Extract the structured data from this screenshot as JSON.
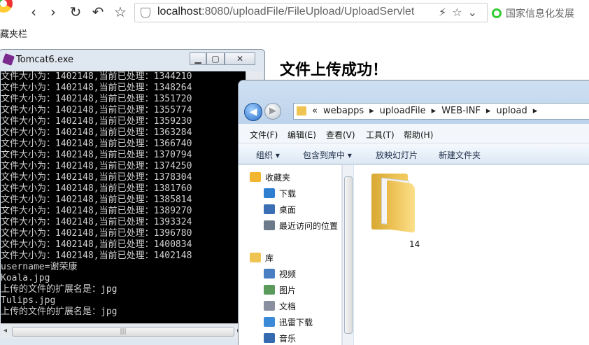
{
  "browser": {
    "address_host": "localhost",
    "address_path": ":8080/uploadFile/FileUpload/UploadServlet",
    "search_text": "国家信息化发展",
    "bookmarks_label": "藏夹栏"
  },
  "page": {
    "heading": "文件上传成功！"
  },
  "console": {
    "title": "Tomcat6.exe",
    "lines": [
      "文件大小为：1402148,当前已处理：1344210",
      "文件大小为：1402148,当前已处理：1348264",
      "文件大小为：1402148,当前已处理：1351720",
      "文件大小为：1402148,当前已处理：1355774",
      "文件大小为：1402148,当前已处理：1359230",
      "文件大小为：1402148,当前已处理：1363284",
      "文件大小为：1402148,当前已处理：1366740",
      "文件大小为：1402148,当前已处理：1370794",
      "文件大小为：1402148,当前已处理：1374250",
      "文件大小为：1402148,当前已处理：1378304",
      "文件大小为：1402148,当前已处理：1381760",
      "文件大小为：1402148,当前已处理：1385814",
      "文件大小为：1402148,当前已处理：1389270",
      "文件大小为：1402148,当前已处理：1393324",
      "文件大小为：1402148,当前已处理：1396780",
      "文件大小为：1402148,当前已处理：1400834",
      "文件大小为：1402148,当前已处理：1402148",
      "username=谢荣康",
      "Koala.jpg",
      "上传的文件的扩展名是：jpg",
      "Tulips.jpg",
      "上传的文件的扩展名是：jpg"
    ]
  },
  "explorer": {
    "breadcrumbs": [
      "«",
      "webapps",
      "▸",
      "uploadFile",
      "▸",
      "WEB-INF",
      "▸",
      "upload",
      "▸"
    ],
    "menu": [
      "文件(F)",
      "编辑(E)",
      "查看(V)",
      "工具(T)",
      "帮助(H)"
    ],
    "toolbar": [
      "组织 ▾",
      "包含到库中 ▾",
      "放映幻灯片",
      "新建文件夹"
    ],
    "favorites": {
      "header": "收藏夹",
      "items": [
        "下载",
        "桌面",
        "最近访问的位置"
      ]
    },
    "library": {
      "header": "库",
      "items": [
        "视频",
        "图片",
        "文档",
        "迅雷下载",
        "音乐"
      ]
    },
    "folder_name": "14"
  },
  "colors": {
    "console_bg": "#000000",
    "console_text": "#d0d0d0",
    "folder": "#f0c452"
  }
}
